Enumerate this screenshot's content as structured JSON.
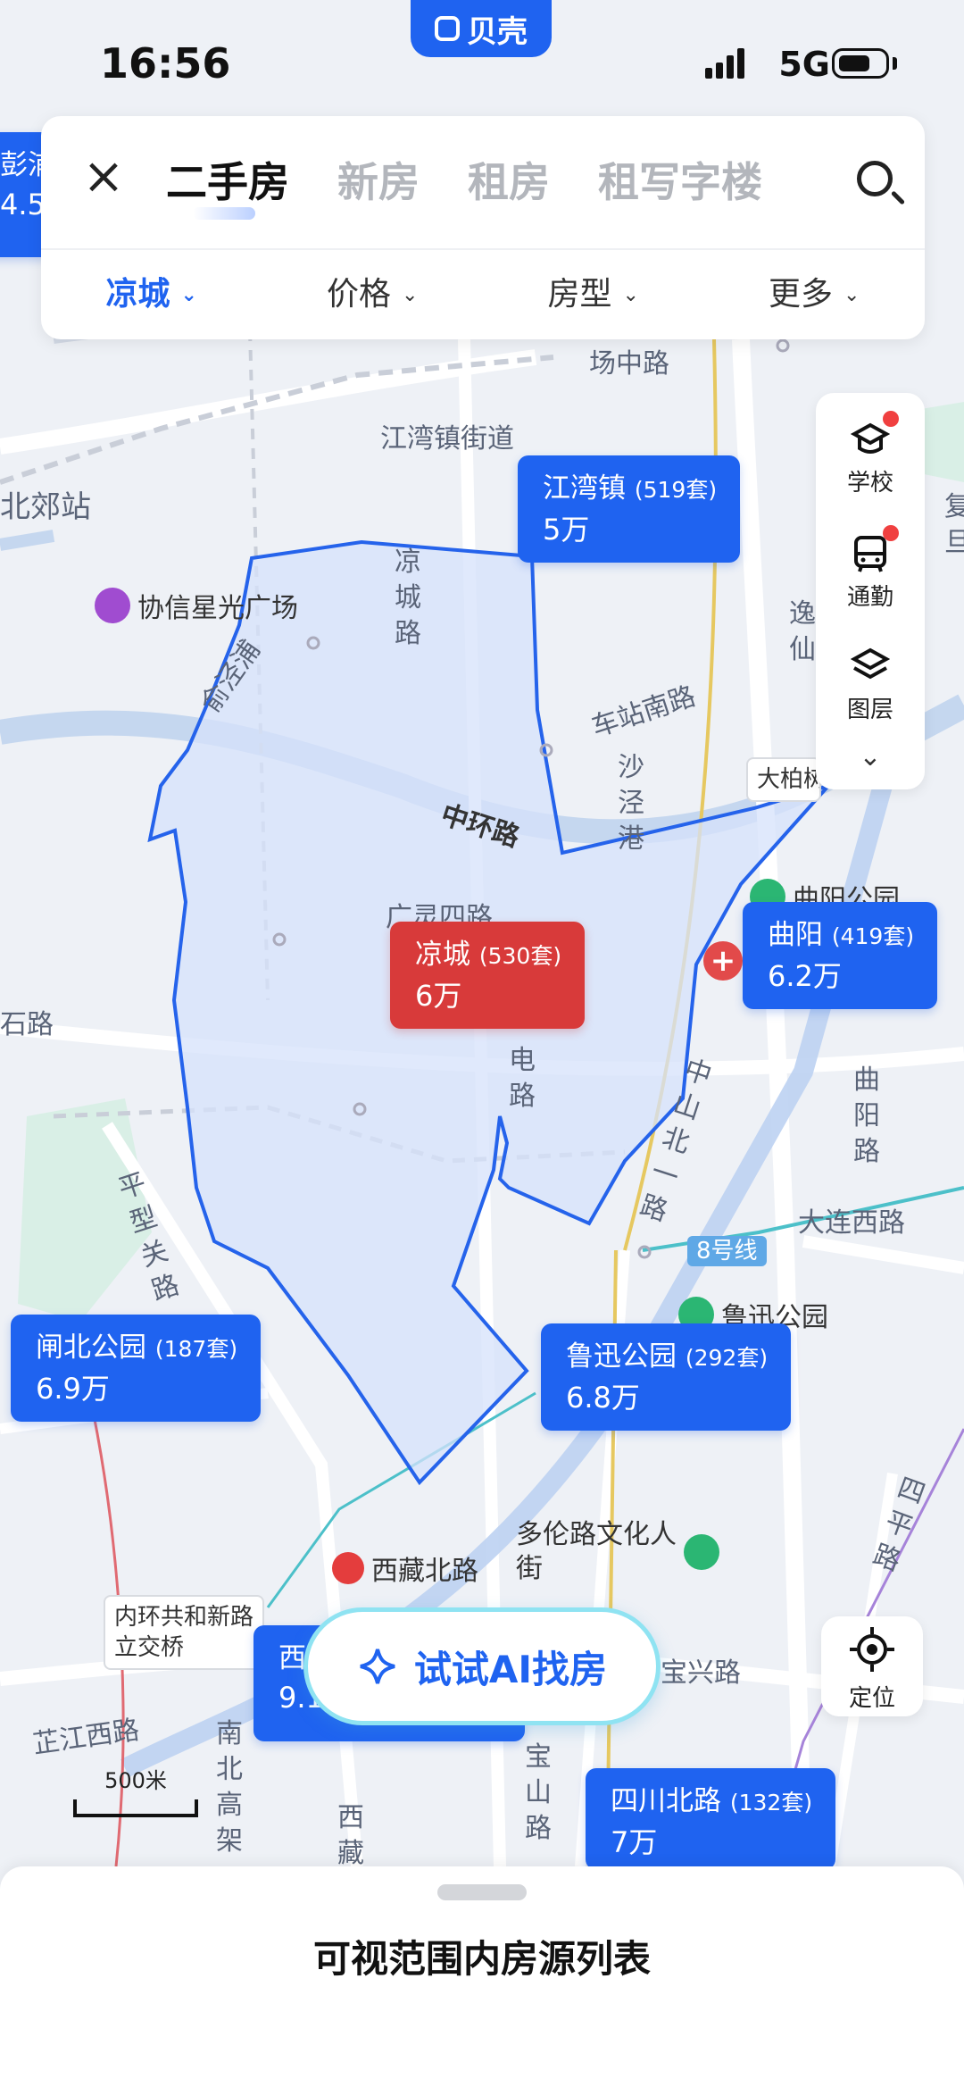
{
  "status_bar": {
    "time": "16:56",
    "network": "5G"
  },
  "brand": {
    "label": "贝壳"
  },
  "search": {
    "tabs": [
      "二手房",
      "新房",
      "租房",
      "租写字楼"
    ],
    "filters": [
      "凉城",
      "价格",
      "房型",
      "更多"
    ]
  },
  "side_tools": [
    {
      "icon": "school-icon",
      "label": "学校",
      "badge": true
    },
    {
      "icon": "commute-icon",
      "label": "通勤",
      "badge": true
    },
    {
      "icon": "layers-icon",
      "label": "图层",
      "badge": false
    }
  ],
  "locate": {
    "label": "定位"
  },
  "ai_button": {
    "label": "试试AI找房"
  },
  "bottom_sheet": {
    "title": "可视范围内房源列表"
  },
  "scale": {
    "label": "500米"
  },
  "colors": {
    "accent": "#1f63f0",
    "selected": "#d83a3a",
    "region_fill": "#d5e2fb",
    "region_stroke": "#2563eb"
  },
  "map": {
    "selected_region": "凉城",
    "bubbles": [
      {
        "name": "江湾镇",
        "count": "(519套)",
        "price": "5万",
        "selected": false
      },
      {
        "name": "凉城",
        "count": "(530套)",
        "price": "6万",
        "selected": true
      },
      {
        "name": "曲阳",
        "count": "(419套)",
        "price": "6.2万",
        "selected": false
      },
      {
        "name": "闸北公园",
        "count": "(187套)",
        "price": "6.9万",
        "selected": false
      },
      {
        "name": "鲁迅公园",
        "count": "(292套)",
        "price": "6.8万",
        "selected": false
      },
      {
        "name": "四川北路",
        "count": "(132套)",
        "price": "7万",
        "selected": false
      },
      {
        "name": "西",
        "count": "",
        "price": "9.1",
        "selected": false
      },
      {
        "name": "彭浦",
        "count": "",
        "price": "4.5",
        "selected": false
      }
    ],
    "labels": {
      "road_changzhong": "场中路",
      "jiangwan_street": "江湾镇街道",
      "beijiao_station": "北郊站",
      "xiexin_plaza": "协信星光广场",
      "liangcheng_road": "凉城路",
      "yujing": "俞泾浦",
      "chezhan_south": "车站南路",
      "shajing": "沙泾港",
      "zhonghuan": "中环路",
      "guangling": "广灵四路",
      "dianlu": "电路",
      "shi_road": "石路",
      "pingxingguan": "平型关路",
      "zhongshan": "中山北一路",
      "quyang_park": "曲阳公园",
      "quyang_road": "曲阳路",
      "dalian_west": "大连西路",
      "line8": "8号线",
      "luxun_park_poi": "鲁迅公园",
      "xitaiyuan": "西宝兴路",
      "duolun": "多伦路文化人街",
      "xizang_north": "西藏北路",
      "interchange": "内环共和新路立交桥",
      "zhijiang_west": "芷江西路",
      "nanbei_elevated": "南北高架",
      "baoshan": "宝山路",
      "baoxing": "宝兴路",
      "siping": "四平路",
      "dabai": "大柏树",
      "yi": "逸仙",
      "fu": "复旦",
      "xiti": "西藏"
    }
  }
}
